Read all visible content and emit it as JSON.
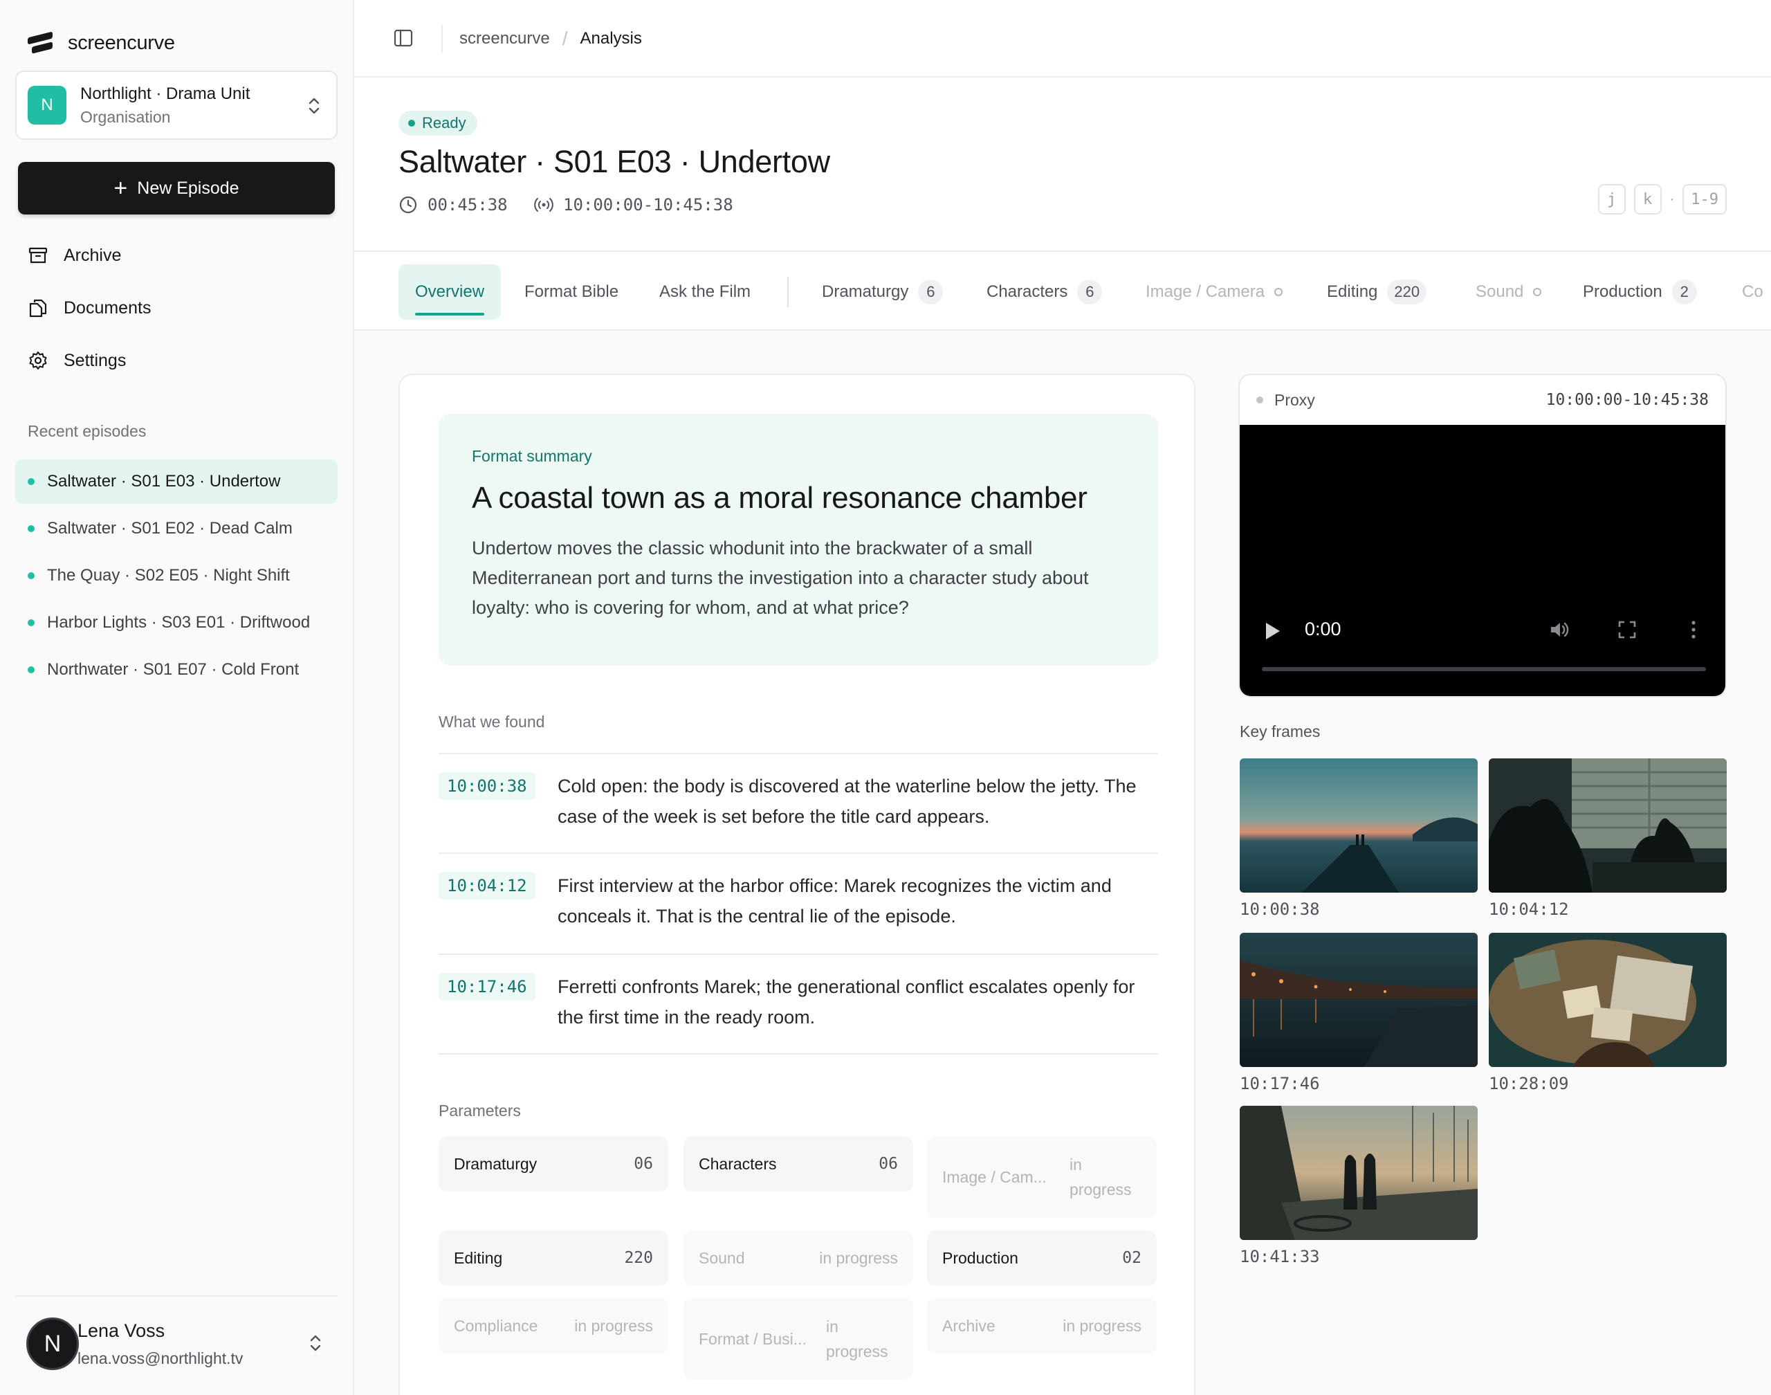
{
  "app": {
    "name": "screencurve"
  },
  "org": {
    "initial": "N",
    "name": "Northlight · Drama Unit",
    "type": "Organisation"
  },
  "sidebar": {
    "new_button": "New Episode",
    "nav": [
      {
        "label": "Archive",
        "icon": "archive-icon"
      },
      {
        "label": "Documents",
        "icon": "documents-icon"
      },
      {
        "label": "Settings",
        "icon": "gear-icon"
      }
    ],
    "recent_label": "Recent episodes",
    "recent": [
      {
        "label": "Saltwater · S01 E03 · Undertow",
        "active": true
      },
      {
        "label": "Saltwater · S01 E02 · Dead Calm",
        "active": false
      },
      {
        "label": "The Quay · S02 E05 · Night Shift",
        "active": false
      },
      {
        "label": "Harbor Lights · S03 E01 · Driftwood",
        "active": false
      },
      {
        "label": "Northwater · S01 E07 · Cold Front",
        "active": false
      }
    ]
  },
  "user": {
    "initial": "N",
    "name": "Lena Voss",
    "email": "lena.voss@northlight.tv"
  },
  "breadcrumb": {
    "root": "screencurve",
    "current": "Analysis"
  },
  "episode": {
    "status": "Ready",
    "title": "Saltwater · S01 E03 · Undertow",
    "duration": "00:45:38",
    "timecode_range": "10:00:00-10:45:38"
  },
  "shortcuts": {
    "keys": [
      "j",
      "k",
      "1-9"
    ],
    "separator": "·"
  },
  "tabs": [
    {
      "label": "Overview",
      "count": null,
      "state": "active"
    },
    {
      "label": "Format Bible",
      "count": null,
      "state": "normal"
    },
    {
      "label": "Ask the Film",
      "count": null,
      "state": "normal"
    },
    {
      "label": "Dramaturgy",
      "count": "6",
      "state": "normal"
    },
    {
      "label": "Characters",
      "count": "6",
      "state": "normal"
    },
    {
      "label": "Image / Camera",
      "count": null,
      "state": "pending"
    },
    {
      "label": "Editing",
      "count": "220",
      "state": "normal"
    },
    {
      "label": "Sound",
      "count": null,
      "state": "pending"
    },
    {
      "label": "Production",
      "count": "2",
      "state": "normal"
    },
    {
      "label": "Co",
      "count": null,
      "state": "pending"
    }
  ],
  "summary": {
    "eyebrow": "Format summary",
    "title": "A coastal town as a moral resonance chamber",
    "body": "Undertow moves the classic whodunit into the brackwater of a small Mediterranean port and turns the investigation into a character study about loyalty: who is covering for whom, and at what price?"
  },
  "findings": {
    "label": "What we found",
    "items": [
      {
        "tc": "10:00:38",
        "text": "Cold open: the body is discovered at the waterline below the jetty. The case of the week is set before the title card appears."
      },
      {
        "tc": "10:04:12",
        "text": "First interview at the harbor office: Marek recognizes the victim and conceals it. That is the central lie of the episode."
      },
      {
        "tc": "10:17:46",
        "text": "Ferretti confronts Marek; the generational conflict escalates openly for the first time in the ready room."
      }
    ]
  },
  "parameters": {
    "label": "Parameters",
    "items": [
      {
        "label": "Dramaturgy",
        "value": "06",
        "pending": false
      },
      {
        "label": "Characters",
        "value": "06",
        "pending": false
      },
      {
        "label": "Image / Cam...",
        "value": "in progress",
        "pending": true
      },
      {
        "label": "Editing",
        "value": "220",
        "pending": false
      },
      {
        "label": "Sound",
        "value": "in progress",
        "pending": true
      },
      {
        "label": "Production",
        "value": "02",
        "pending": false
      },
      {
        "label": "Compliance",
        "value": "in progress",
        "pending": true
      },
      {
        "label": "Format / Busi...",
        "value": "in progress",
        "pending": true
      },
      {
        "label": "Archive",
        "value": "in progress",
        "pending": true
      }
    ]
  },
  "player": {
    "label": "Proxy",
    "range": "10:00:00-10:45:38",
    "time": "0:00",
    "progress": 0
  },
  "keyframes": {
    "label": "Key frames",
    "items": [
      {
        "tc": "10:00:38",
        "scene": "dusk-jetty"
      },
      {
        "tc": "10:04:12",
        "scene": "office-silhouettes"
      },
      {
        "tc": "10:17:46",
        "scene": "night-harbor"
      },
      {
        "tc": "10:28:09",
        "scene": "desk-evidence"
      },
      {
        "tc": "10:41:33",
        "scene": "boat-deck-figures"
      }
    ]
  },
  "colors": {
    "accent": "#14a38b",
    "accent_bg": "#e4f5f1",
    "dark": "#18181b"
  }
}
